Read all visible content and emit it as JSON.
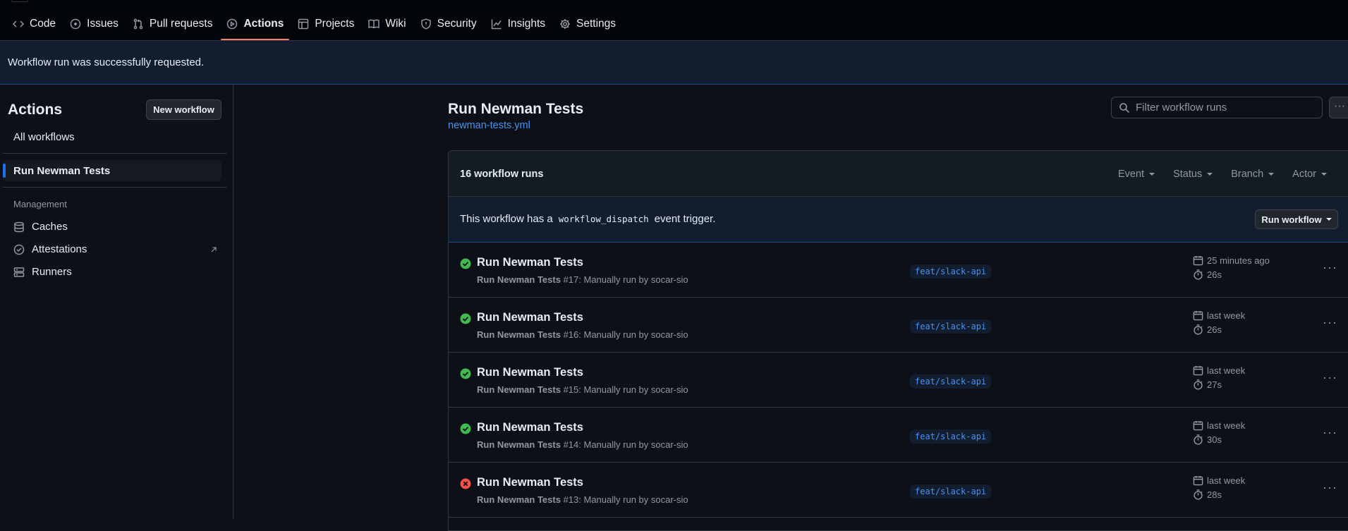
{
  "repo_nav": {
    "tabs": [
      {
        "label": "Code",
        "icon": "code-icon"
      },
      {
        "label": "Issues",
        "icon": "issue-icon"
      },
      {
        "label": "Pull requests",
        "icon": "pull-request-icon"
      },
      {
        "label": "Actions",
        "icon": "play-icon",
        "active": true
      },
      {
        "label": "Projects",
        "icon": "table-icon"
      },
      {
        "label": "Wiki",
        "icon": "book-icon"
      },
      {
        "label": "Security",
        "icon": "shield-icon"
      },
      {
        "label": "Insights",
        "icon": "graph-icon"
      },
      {
        "label": "Settings",
        "icon": "gear-icon"
      }
    ]
  },
  "flash": {
    "message": "Workflow run was successfully requested."
  },
  "sidebar": {
    "title": "Actions",
    "new_workflow_label": "New workflow",
    "all_workflows_label": "All workflows",
    "selected_workflow": "Run Newman Tests",
    "management_label": "Management",
    "items": [
      {
        "label": "Caches",
        "icon": "database-icon"
      },
      {
        "label": "Attestations",
        "icon": "check-circle-icon",
        "external_icon": "arrow-up-right-icon"
      },
      {
        "label": "Runners",
        "icon": "server-icon"
      }
    ]
  },
  "workflow": {
    "title": "Run Newman Tests",
    "file": "newman-tests.yml",
    "filter_placeholder": "Filter workflow runs",
    "more_label": "···"
  },
  "runs_box": {
    "count_label": "16 workflow runs",
    "filters": [
      "Event",
      "Status",
      "Branch",
      "Actor"
    ],
    "dispatch": {
      "text_before": "This workflow has a",
      "code": "workflow_dispatch",
      "text_after": "event trigger.",
      "button_label": "Run workflow"
    }
  },
  "runs": [
    {
      "status": "success",
      "title": "Run Newman Tests",
      "sub_name": "Run Newman Tests",
      "sub_rest": "#17: Manually run by socar-sio",
      "branch": "feat/slack-api",
      "when": "25 minutes ago",
      "duration": "26s"
    },
    {
      "status": "success",
      "title": "Run Newman Tests",
      "sub_name": "Run Newman Tests",
      "sub_rest": "#16: Manually run by socar-sio",
      "branch": "feat/slack-api",
      "when": "last week",
      "duration": "26s"
    },
    {
      "status": "success",
      "title": "Run Newman Tests",
      "sub_name": "Run Newman Tests",
      "sub_rest": "#15: Manually run by socar-sio",
      "branch": "feat/slack-api",
      "when": "last week",
      "duration": "27s"
    },
    {
      "status": "success",
      "title": "Run Newman Tests",
      "sub_name": "Run Newman Tests",
      "sub_rest": "#14: Manually run by socar-sio",
      "branch": "feat/slack-api",
      "when": "last week",
      "duration": "30s"
    },
    {
      "status": "failure",
      "title": "Run Newman Tests",
      "sub_name": "Run Newman Tests",
      "sub_rest": "#13: Manually run by socar-sio",
      "branch": "feat/slack-api",
      "when": "last week",
      "duration": "28s"
    }
  ],
  "colors": {
    "accent": "#f78166",
    "link": "#4493f8",
    "success": "#3fb950",
    "failure": "#f85149"
  }
}
